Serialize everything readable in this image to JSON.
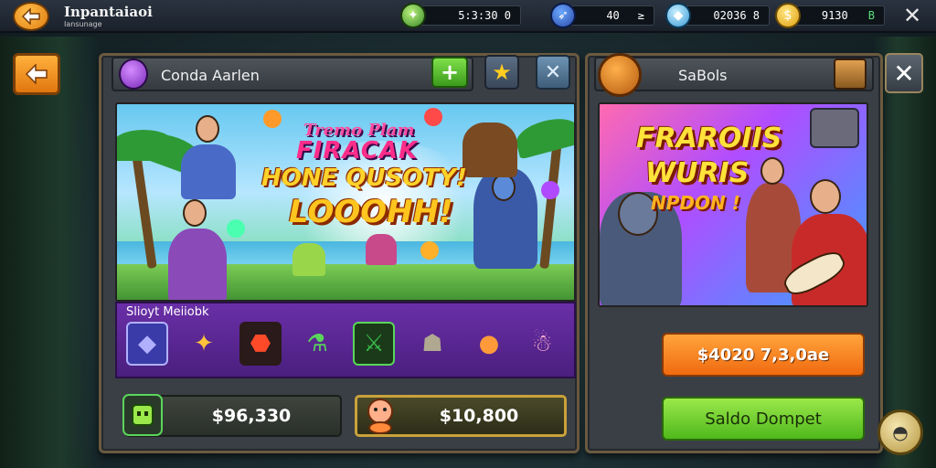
{
  "topbar": {
    "title": "Inpantaiaoi",
    "subtitle": "Iansunage",
    "resources": [
      {
        "icon": "gem-bag-icon",
        "value": "5:3:30  0"
      },
      {
        "icon": "rocket-icon",
        "value": "40",
        "suffix": "≥"
      },
      {
        "icon": "diamond-icon",
        "value": "02036  8"
      },
      {
        "icon": "coin-icon",
        "value": "9130",
        "suffix": "B"
      }
    ],
    "close_glyph": "✕"
  },
  "left_panel": {
    "title": "Conda Aarlen",
    "banner": {
      "line1": "Tremo Plam",
      "line2": "FIRACAK",
      "line3": "HONE QUSOTY!",
      "line4": "LOOOHH!"
    },
    "items_label": "Slioyt Meiiobk",
    "items": [
      {
        "icon": "crystal-icon",
        "glyph": "◆",
        "color": "#7a7aff"
      },
      {
        "icon": "treasure-pile-icon",
        "glyph": "✦",
        "color": "#ffc43a"
      },
      {
        "icon": "red-gem-icon",
        "glyph": "⬣",
        "color": "#ff4a2a"
      },
      {
        "icon": "potion-bundle-icon",
        "glyph": "⚗",
        "color": "#5ad65a"
      },
      {
        "icon": "green-sword-icon",
        "glyph": "⚔",
        "color": "#3ab84a"
      },
      {
        "icon": "stone-cat-icon",
        "glyph": "☗",
        "color": "#b0a890"
      },
      {
        "icon": "orange-creature-icon",
        "glyph": "●",
        "color": "#ff9a3a"
      },
      {
        "icon": "pink-ghost-icon",
        "glyph": "☃",
        "color": "#ffb0d0"
      }
    ],
    "price_a": "$96,330",
    "price_b": "$10,800"
  },
  "right_panel": {
    "title": "SaBols",
    "banner": {
      "line1": "FRAROIIS",
      "line2": "WURIS",
      "line3": "NPDON !"
    },
    "orange_button": "$4020 7,3,0ae",
    "green_button": "Saldo Dompet"
  },
  "colors": {
    "accent_orange": "#f08a1c",
    "accent_green": "#5ac21c",
    "panel_bg": "#3a3f45",
    "strip_purple": "#5a25a0"
  }
}
